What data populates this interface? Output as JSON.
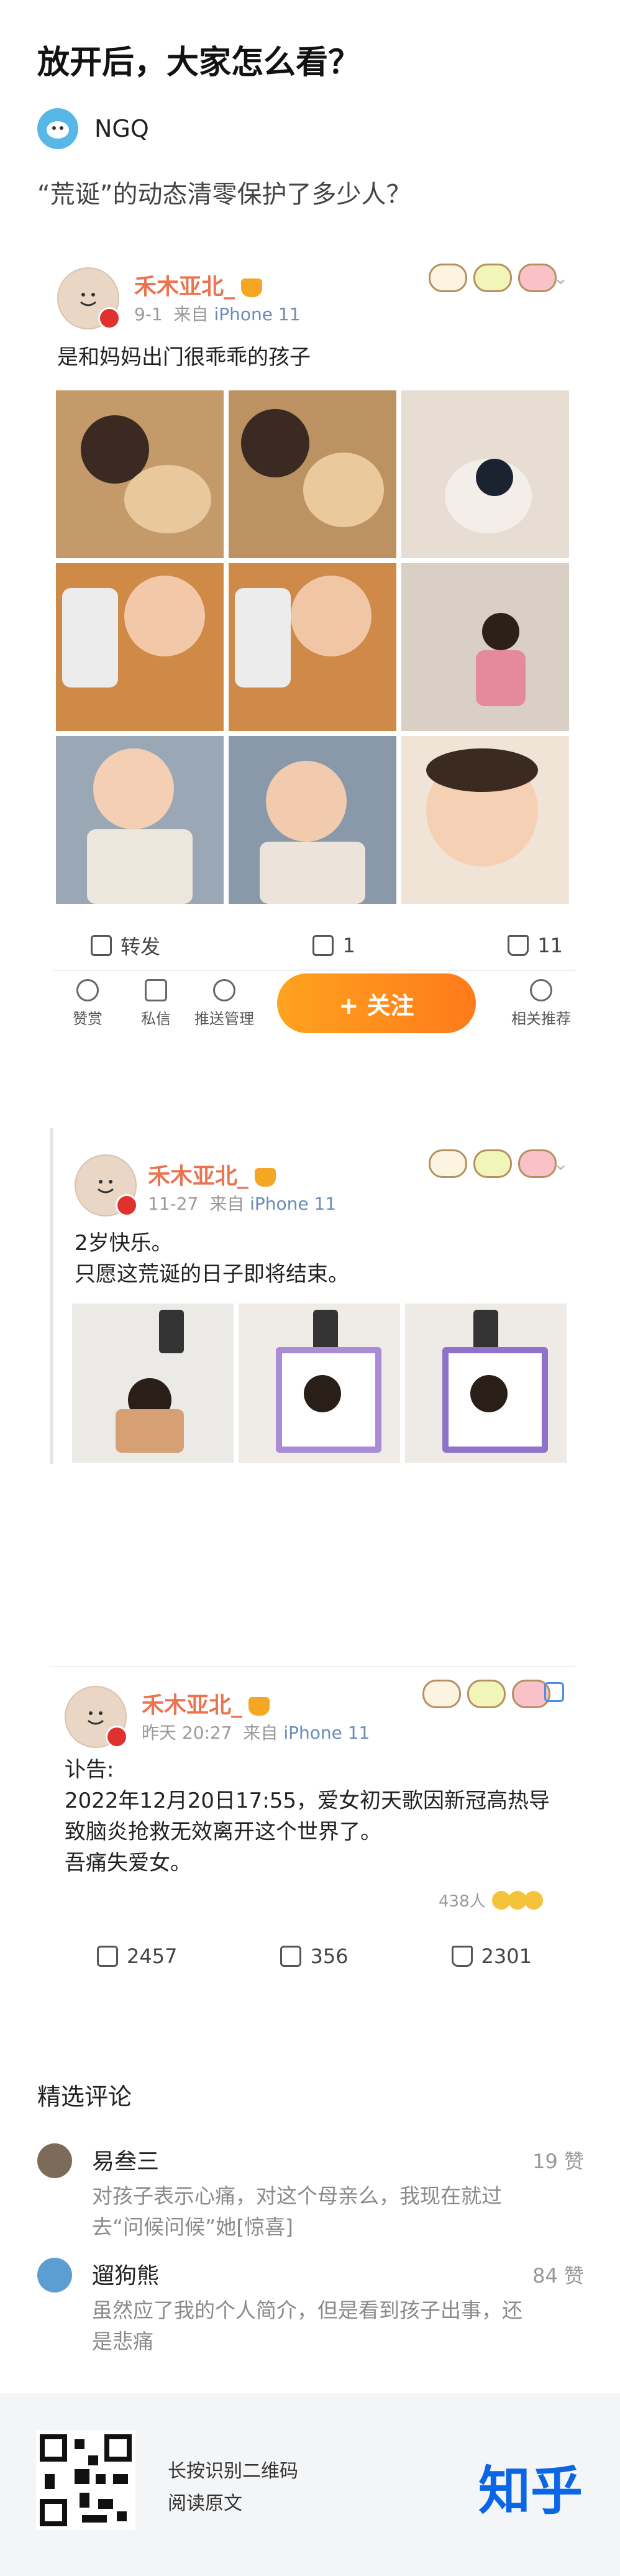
{
  "title": "放开后，大家怎么看？",
  "author": {
    "name": "NGQ"
  },
  "question": "“荒诞”的动态清零保护了多少人？",
  "posts": [
    {
      "name": "禾木亚北_",
      "date": "9-1",
      "source_prefix": "来自",
      "device": "iPhone 11",
      "text": "是和妈妈出门很乖乖的孩子",
      "repost_label": "转发",
      "comment_count": "1",
      "like_count": "11",
      "toolbar": {
        "reward": "赞赏",
        "message": "私信",
        "push": "推送管理",
        "follow": "+ 关注",
        "related": "相关推荐"
      }
    },
    {
      "name": "禾木亚北_",
      "date": "11-27",
      "source_prefix": "来自",
      "device": "iPhone 11",
      "lines": [
        "2岁快乐。",
        "只愿这荒诞的日子即将结束。"
      ]
    },
    {
      "name": "禾木亚北_",
      "date": "昨天 20:27",
      "source_prefix": "来自",
      "device": "iPhone 11",
      "lines": [
        "讣告:",
        "2022年12月20日17:55，爱女初天歌因新冠高热导",
        "致脑炎抢救无效离开这个世界了。",
        "吾痛失爱女。"
      ],
      "reaction_count": "438人",
      "repost_count": "2457",
      "comment_count": "356",
      "like_count": "2301"
    }
  ],
  "comments_section_title": "精选评论",
  "comments": [
    {
      "name": "易叁三",
      "likes": "19 赞",
      "text": "对孩子表示心痛，对这个母亲么，我现在就过去“问候问候”她[惊喜]"
    },
    {
      "name": "遛狗熊",
      "likes": "84 赞",
      "text": "虽然应了我的个人简介，但是看到孩子出事，还是悲痛"
    }
  ],
  "footer": {
    "line1": "长按识别二维码",
    "line2": "阅读原文",
    "logo": "知乎"
  },
  "colors": {
    "accent_orange": "#ff8c1a",
    "name_color": "#eb7350",
    "zhihu_blue": "#0a66e4"
  }
}
